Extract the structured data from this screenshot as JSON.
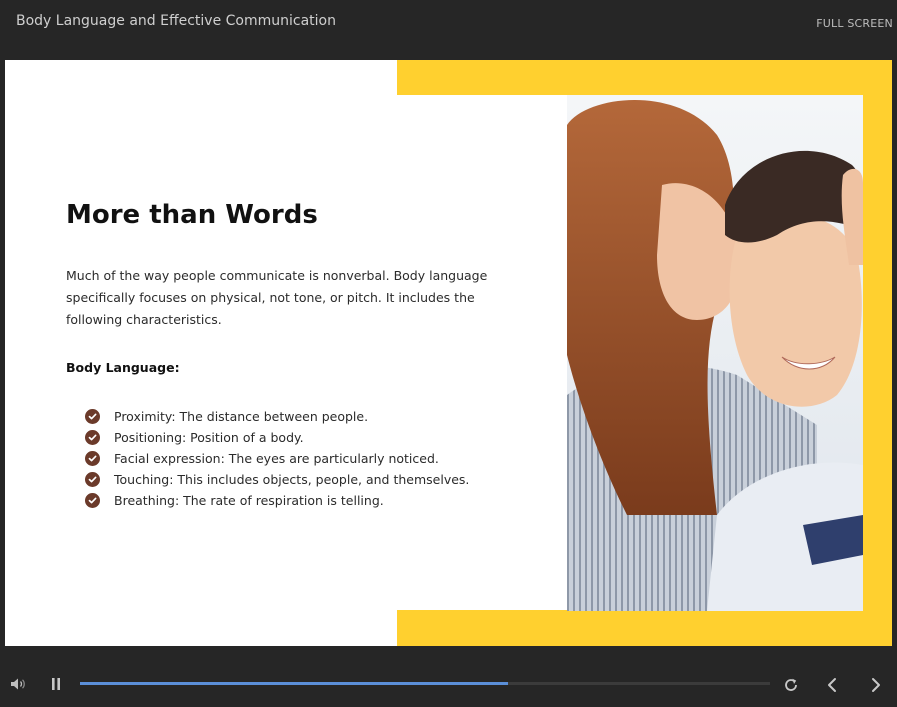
{
  "app": {
    "course_title": "Body Language and Effective Communication",
    "fullscreen_label": "FULL SCREEN"
  },
  "slide": {
    "heading": "More than Words",
    "intro": "Much of the way people communicate is nonverbal. Body language specifically focuses on physical, not tone, or pitch. It includes the following characteristics.",
    "list_heading": "Body Language:",
    "items": [
      {
        "label": "Proximity: The distance between people.",
        "icon": "check-circle-icon"
      },
      {
        "label": "Positioning: Position of a body.",
        "icon": "check-circle-icon"
      },
      {
        "label": "Facial expression: The eyes are particularly noticed.",
        "icon": "check-circle-icon"
      },
      {
        "label": "Touching: This includes objects, people, and themselves.",
        "icon": "check-circle-icon"
      },
      {
        "label": "Breathing: The rate of respiration is telling.",
        "icon": "check-circle-icon"
      }
    ],
    "accent_color": "#ffd02f",
    "check_color": "#6b3a2a"
  },
  "player": {
    "progress": 0.62,
    "icons": [
      "volume-icon",
      "pause-icon",
      "replay-icon",
      "previous-icon",
      "next-icon"
    ],
    "progress_color": "#5b8fd8"
  }
}
